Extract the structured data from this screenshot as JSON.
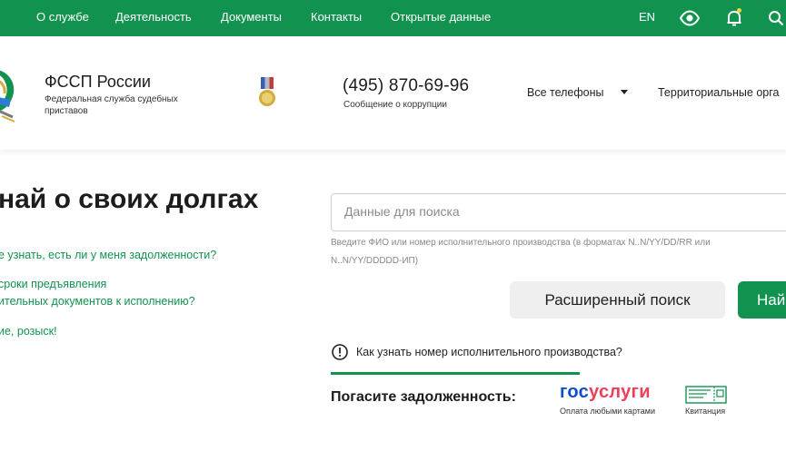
{
  "topnav": {
    "links": [
      "О службе",
      "Деятельность",
      "Документы",
      "Контакты",
      "Открытые данные"
    ],
    "lang": "EN"
  },
  "header": {
    "org_name": "ФССП России",
    "org_full": "Федеральная служба судебных приставов",
    "phone": "(495) 870-69-96",
    "phone_sub": "Сообщение о коррупции",
    "all_phones": "Все телефоны",
    "territorial": "Территориальные орга"
  },
  "hero": {
    "title": "най о своих долгах",
    "links": [
      "е узнать, есть ли у меня задолженности?",
      "сроки предъявления",
      "ительных документов к исполнению?",
      "ие, розыск!"
    ]
  },
  "search": {
    "placeholder": "Данные для поиска",
    "value": "",
    "hint": "Введите ФИО или номер исполнительного производства (в форматах N..N/YY/DD/RR или N..N/YY/DDDDD-ИП)",
    "advanced_label": "Расширенный поиск",
    "find_label": "Най",
    "howto": "Как узнать номер исполнительного производства?"
  },
  "payment": {
    "title": "Погасите задолженность:",
    "gosuslugi_blue": "гос",
    "gosuslugi_red": "услуги",
    "gosuslugi_sub": "Оплата любыми картами",
    "kvit_sub": "Квитанция"
  },
  "colors": {
    "brand_green": "#12924f",
    "gos_blue": "#0d4cd3",
    "gos_red": "#ee3f58"
  }
}
